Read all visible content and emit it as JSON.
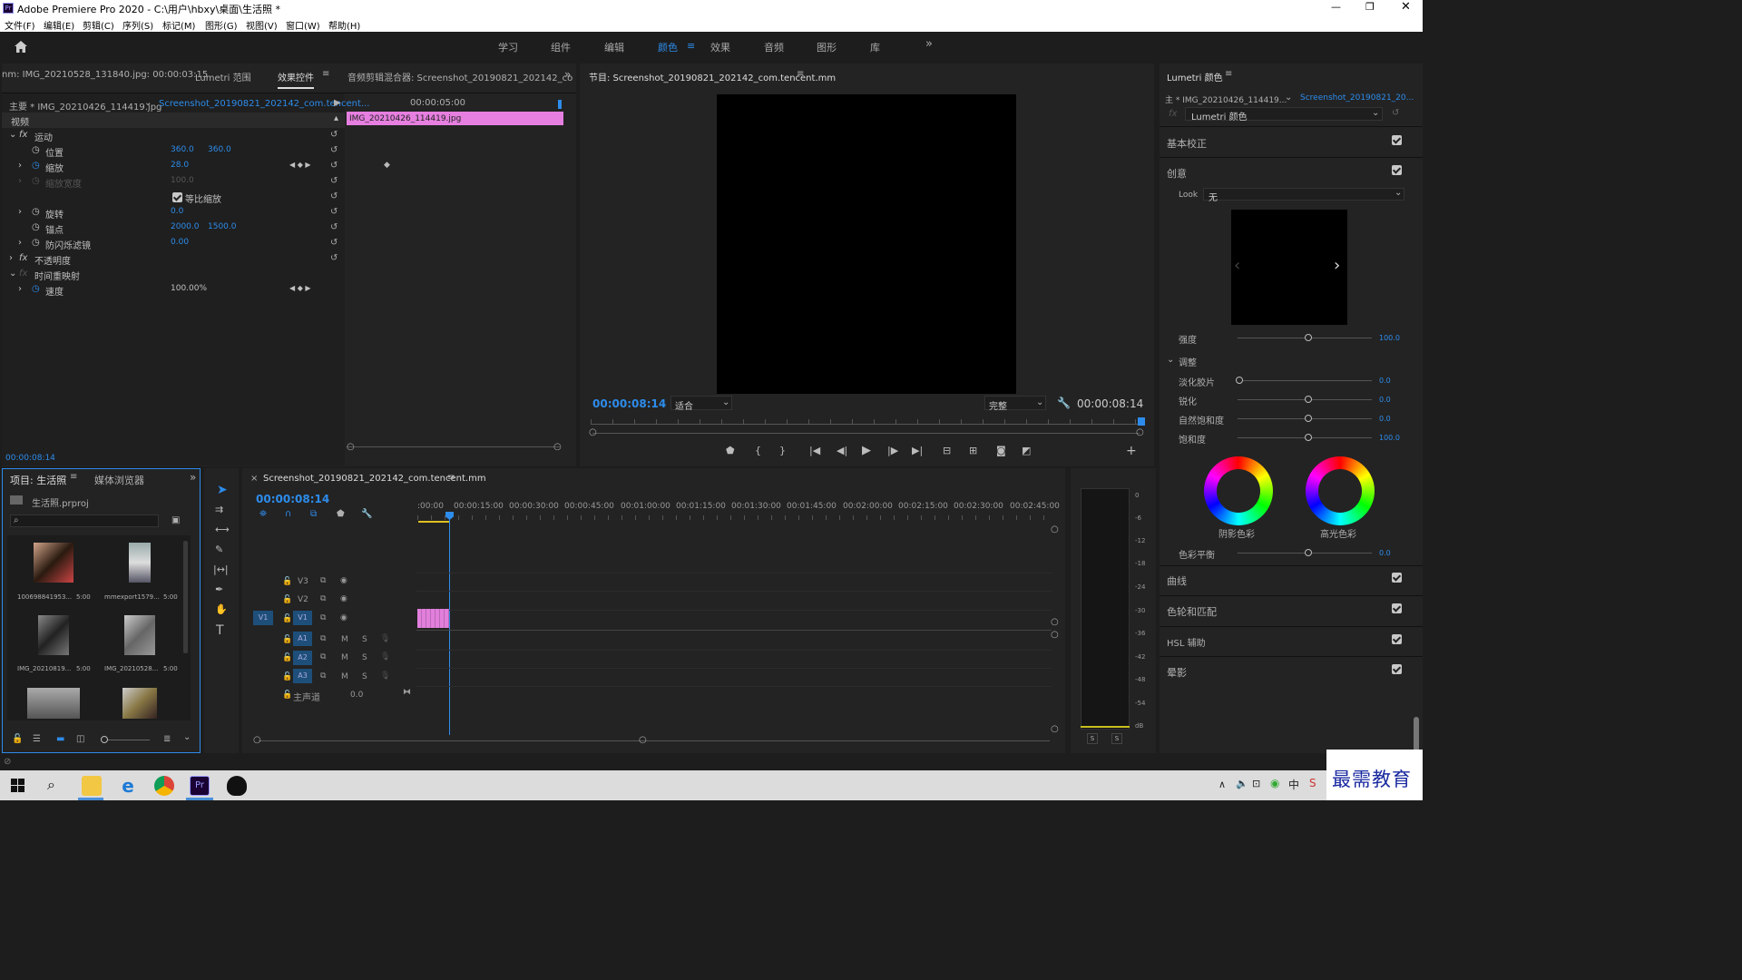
{
  "title": "Adobe Premiere Pro 2020 - C:\\用户\\hbxy\\桌面\\生活照 *",
  "menu": [
    "文件(F)",
    "编辑(E)",
    "剪辑(C)",
    "序列(S)",
    "标记(M)",
    "图形(G)",
    "视图(V)",
    "窗口(W)",
    "帮助(H)"
  ],
  "workspaces": [
    "学习",
    "组件",
    "编辑",
    "颜色",
    "效果",
    "音频",
    "图形",
    "库"
  ],
  "top_left_tabs": {
    "source": "nm: IMG_20210528_131840.jpg: 00:00:03:15",
    "lumetri_scope": "Lumetri 范围",
    "effect_controls": "效果控件",
    "audio_mixer": "音频剪辑混合器: Screenshot_20190821_202142_co"
  },
  "ec": {
    "master": "主要 * IMG_20210426_114419.jpg",
    "clip": "Screenshot_20190821_202142_com.tencent...",
    "time_ruler": "00:00:05:00",
    "clip_bar": "IMG_20210426_114419.jpg",
    "video": "视频",
    "motion": "运动",
    "position": "位置",
    "pos_x": "360.0",
    "pos_y": "360.0",
    "scale": "缩放",
    "scale_val": "28.0",
    "scale_w": "缩放宽度",
    "scale_w_val": "100.0",
    "uniform": "等比缩放",
    "rotation": "旋转",
    "rot_val": "0.0",
    "anchor": "锚点",
    "anc_x": "2000.0",
    "anc_y": "1500.0",
    "flicker": "防闪烁滤镜",
    "flicker_val": "0.00",
    "opacity": "不透明度",
    "time_remap": "时间重映射",
    "speed": "速度",
    "speed_val": "100.00%",
    "timecode": "00:00:08:14"
  },
  "program": {
    "title": "节目: Screenshot_20190821_202142_com.tencent.mm",
    "tc_left": "00:00:08:14",
    "fit": "适合",
    "quality": "完整",
    "tc_right": "00:00:08:14"
  },
  "lumetri": {
    "title": "Lumetri 颜色",
    "master": "主 * IMG_20210426_114419...",
    "clip": "Screenshot_20190821_20...",
    "effect": "Lumetri 颜色",
    "basic": "基本校正",
    "creative": "创意",
    "look_label": "Look",
    "look_val": "无",
    "intensity": "强度",
    "intensity_val": "100.0",
    "adjust": "调整",
    "faded": "淡化胶片",
    "faded_val": "0.0",
    "sharpen": "锐化",
    "sharpen_val": "0.0",
    "vibrance": "自然饱和度",
    "vibrance_val": "0.0",
    "saturation": "饱和度",
    "saturation_val": "100.0",
    "shadow_tint": "阴影色彩",
    "highlight_tint": "高光色彩",
    "tint_balance": "色彩平衡",
    "tint_balance_val": "0.0",
    "curves": "曲线",
    "wheels": "色轮和匹配",
    "hsl": "HSL 辅助",
    "vignette": "晕影"
  },
  "project": {
    "tab1": "项目: 生活照",
    "tab2": "媒体浏览器",
    "file": "生活照.prproj",
    "items": [
      {
        "name": "100698841953...",
        "dur": "5:00"
      },
      {
        "name": "mmexport1579...",
        "dur": "5:00"
      },
      {
        "name": "IMG_20210819...",
        "dur": "5:00"
      },
      {
        "name": "IMG_20210528...",
        "dur": "5:00"
      }
    ]
  },
  "timeline": {
    "tab": "Screenshot_20190821_202142_com.tencent.mm",
    "tc": "00:00:08:14",
    "ruler": [
      ":00:00",
      "00:00:15:00",
      "00:00:30:00",
      "00:00:45:00",
      "00:01:00:00",
      "00:01:15:00",
      "00:01:30:00",
      "00:01:45:00",
      "00:02:00:00",
      "00:02:15:00",
      "00:02:30:00",
      "00:02:45:00"
    ],
    "tracks_v": [
      "V3",
      "V2",
      "V1"
    ],
    "tracks_a": [
      "A1",
      "A2",
      "A3"
    ],
    "src_v": "V1",
    "master": "主声道",
    "master_val": "0.0",
    "m": "M",
    "s": "S"
  },
  "meter": {
    "scale": [
      "0",
      "-6",
      "-12",
      "-18",
      "-24",
      "-30",
      "-36",
      "-42",
      "-48",
      "-54",
      "dB"
    ],
    "s": "S"
  },
  "watermark": "最需教育"
}
